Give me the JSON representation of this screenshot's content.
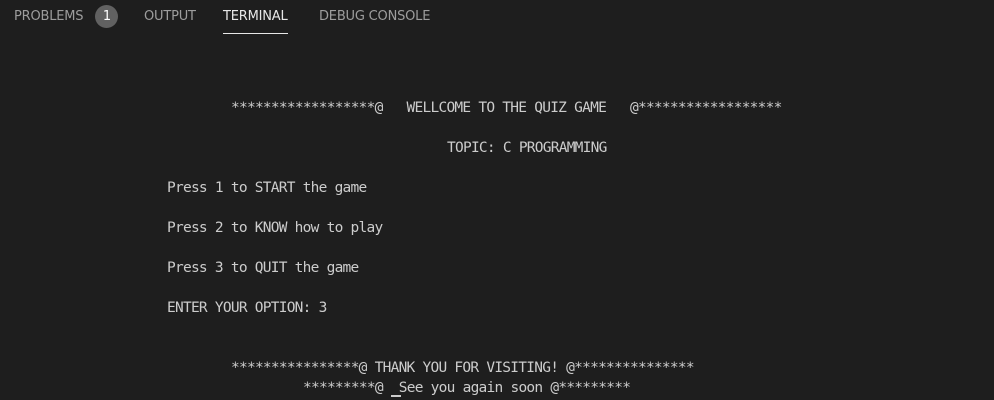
{
  "tabs": {
    "problems": {
      "label": "PROBLEMS",
      "badge": "1"
    },
    "output": {
      "label": "OUTPUT"
    },
    "terminal": {
      "label": "TERMINAL"
    },
    "debug_console": {
      "label": "DEBUG CONSOLE"
    }
  },
  "terminal": {
    "lines": {
      "welcome": "******************@   WELLCOME TO THE QUIZ GAME   @******************",
      "topic": "TOPIC: C PROGRAMMING",
      "option1": "Press 1 to START the game",
      "option2": "Press 2 to KNOW how to play",
      "option3": "Press 3 to QUIT the game",
      "enter_option": "ENTER YOUR OPTION: 3",
      "thanks": "****************@ THANK YOU FOR VISITING! @***************",
      "see_you": "*********@  See you again soon @*********"
    }
  },
  "colors": {
    "background": "#1e1e1e",
    "terminal_text": "#cccccc",
    "inactive_tab": "#9d9d9d",
    "active_tab": "#e7e7e7",
    "badge_bg": "#616161"
  }
}
